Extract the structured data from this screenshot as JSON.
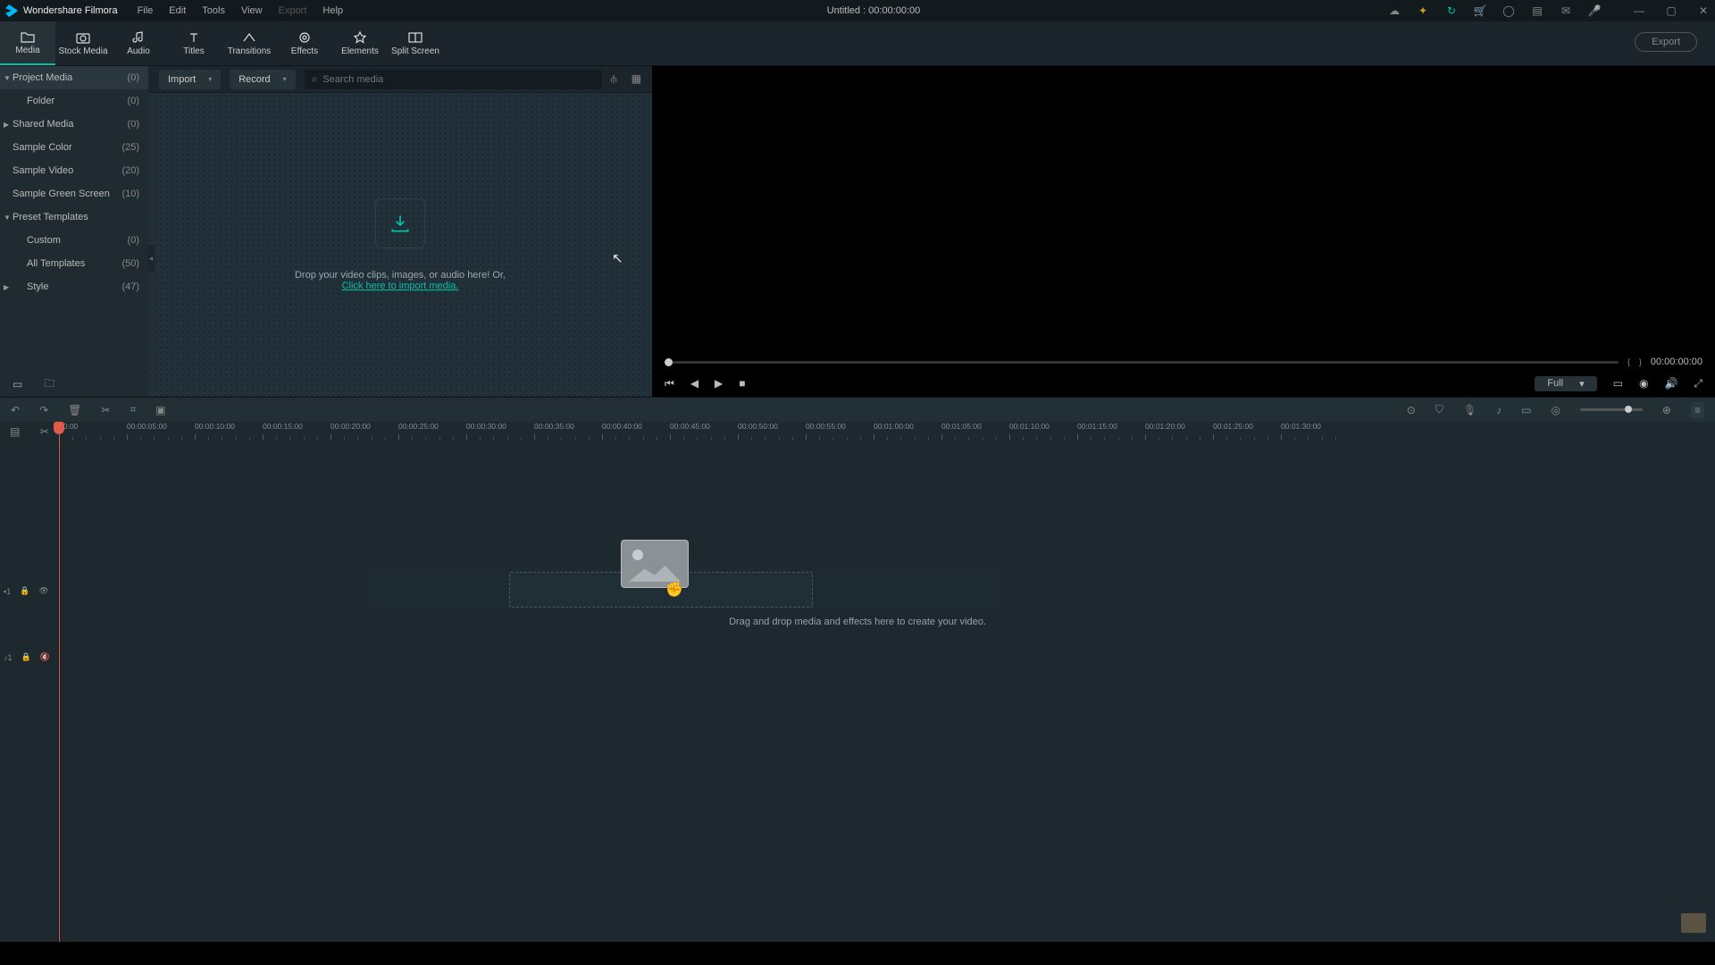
{
  "app": {
    "name": "Wondershare Filmora"
  },
  "menus": [
    "File",
    "Edit",
    "Tools",
    "View",
    "Export",
    "Help"
  ],
  "disabled_menus": [
    "Export"
  ],
  "title_center": "Untitled : 00:00:00:00",
  "tabs": [
    {
      "label": "Media"
    },
    {
      "label": "Stock Media"
    },
    {
      "label": "Audio"
    },
    {
      "label": "Titles"
    },
    {
      "label": "Transitions"
    },
    {
      "label": "Effects"
    },
    {
      "label": "Elements"
    },
    {
      "label": "Split Screen"
    }
  ],
  "export_label": "Export",
  "sidebar": [
    {
      "label": "Project Media",
      "count": "(0)",
      "sel": true,
      "arrow": "▼"
    },
    {
      "label": "Folder",
      "count": "(0)",
      "indent": 1
    },
    {
      "label": "Shared Media",
      "count": "(0)",
      "arrow": "▶"
    },
    {
      "label": "Sample Color",
      "count": "(25)"
    },
    {
      "label": "Sample Video",
      "count": "(20)"
    },
    {
      "label": "Sample Green Screen",
      "count": "(10)"
    },
    {
      "label": "Preset Templates",
      "count": "",
      "arrow": "▼"
    },
    {
      "label": "Custom",
      "count": "(0)",
      "indent": 1
    },
    {
      "label": "All Templates",
      "count": "(50)",
      "indent": 1
    },
    {
      "label": "Style",
      "count": "(47)",
      "indent": 1,
      "arrow": "▶"
    }
  ],
  "toolbar2": {
    "import": "Import",
    "record": "Record",
    "search_ph": "Search media"
  },
  "drop": {
    "text": "Drop your video clips, images, or audio here! Or,",
    "link": "Click here to import media."
  },
  "preview": {
    "time": "00:00:00:00",
    "quality": "Full"
  },
  "timeline": {
    "ticks": [
      "00:00",
      "00:00:05:00",
      "00:00:10:00",
      "00:00:15:00",
      "00:00:20:00",
      "00:00:25:00",
      "00:00:30:00",
      "00:00:35:00",
      "00:00:40:00",
      "00:00:45:00",
      "00:00:50:00",
      "00:00:55:00",
      "00:01:00:00",
      "00:01:05:00",
      "00:01:10:00",
      "00:01:15:00",
      "00:01:20:00",
      "00:01:25:00",
      "00:01:30:00"
    ],
    "hint": "Drag and drop media and effects here to create your video."
  }
}
